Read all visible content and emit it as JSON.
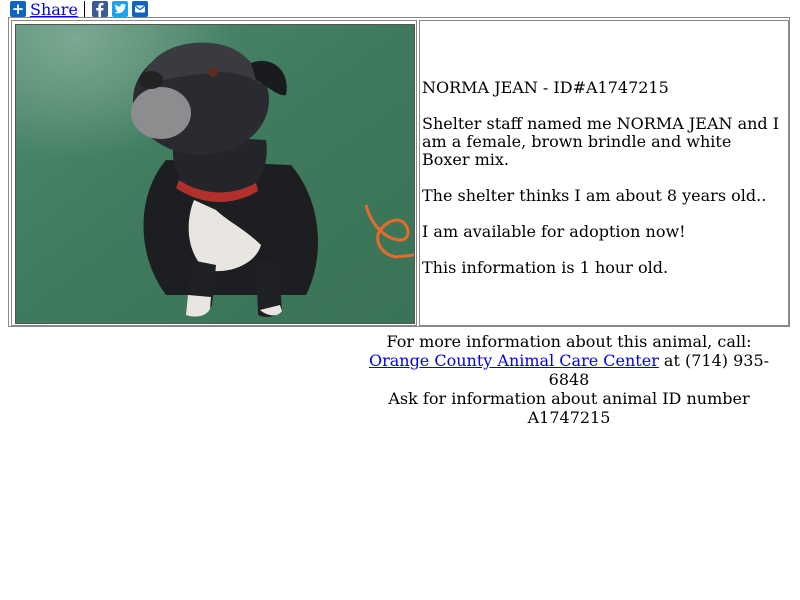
{
  "share": {
    "label": "Share",
    "icons": [
      "facebook-icon",
      "twitter-icon",
      "email-icon"
    ],
    "colors": {
      "plus": "#0a66c2",
      "facebook": "#3b5998",
      "twitter": "#1da1f2",
      "email": "#0a66c2"
    }
  },
  "animal": {
    "title": "NORMA JEAN - ID#A1747215",
    "description": "Shelter staff named me NORMA JEAN and I am a female, brown brindle and white Boxer mix.",
    "age": "The shelter thinks I am about 8 years old..",
    "availability": "I am available for adoption now!",
    "freshness": "This information is 1 hour old."
  },
  "contact": {
    "line1": "For more information about this animal, call:",
    "shelter_name": "Orange County Animal Care Center",
    "at_phone": " at (714) 935-6848",
    "line3": "Ask for information about animal ID number A1747215"
  }
}
